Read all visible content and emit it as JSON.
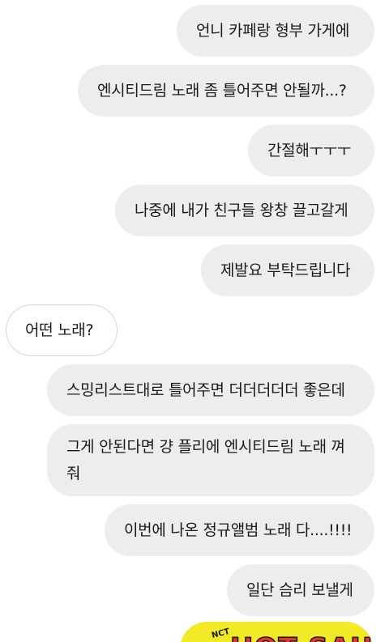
{
  "messages": [
    {
      "sender": "me",
      "text": "언니 카페랑 형부 가게에"
    },
    {
      "sender": "me",
      "text": "엔시티드림 노래 좀 틀어주면 안될까...?"
    },
    {
      "sender": "me",
      "text": "간절해ㅜㅜㅜ"
    },
    {
      "sender": "me",
      "text": "나중에 내가 친구들 왕창 끌고갈게"
    },
    {
      "sender": "me",
      "text": "제발요 부탁드립니다"
    },
    {
      "sender": "them",
      "text": "어떤 노래?"
    },
    {
      "sender": "me",
      "text": "스밍리스트대로 틀어주면 더더더더더 좋은데"
    },
    {
      "sender": "me",
      "text_line1": "그게 안된다면 걍 플리에 엔시티드림 노래 껴",
      "text_line2": "줘"
    },
    {
      "sender": "me",
      "text": "이번에 나온 정규앨범 노래 다....!!!!"
    },
    {
      "sender": "me",
      "text": "일단 슴리 보낼게"
    }
  ],
  "sticker": {
    "text": "HOT SAUCE",
    "colors": {
      "background": "#f3ea27",
      "letters": "#e8342c",
      "outline": "#1a1a1a"
    }
  },
  "colors": {
    "background": "#ffffff",
    "outgoing_bubble": "#ededed",
    "incoming_bubble": "#ffffff",
    "incoming_border": "#d6d6d6",
    "text": "#1a1a1a"
  }
}
